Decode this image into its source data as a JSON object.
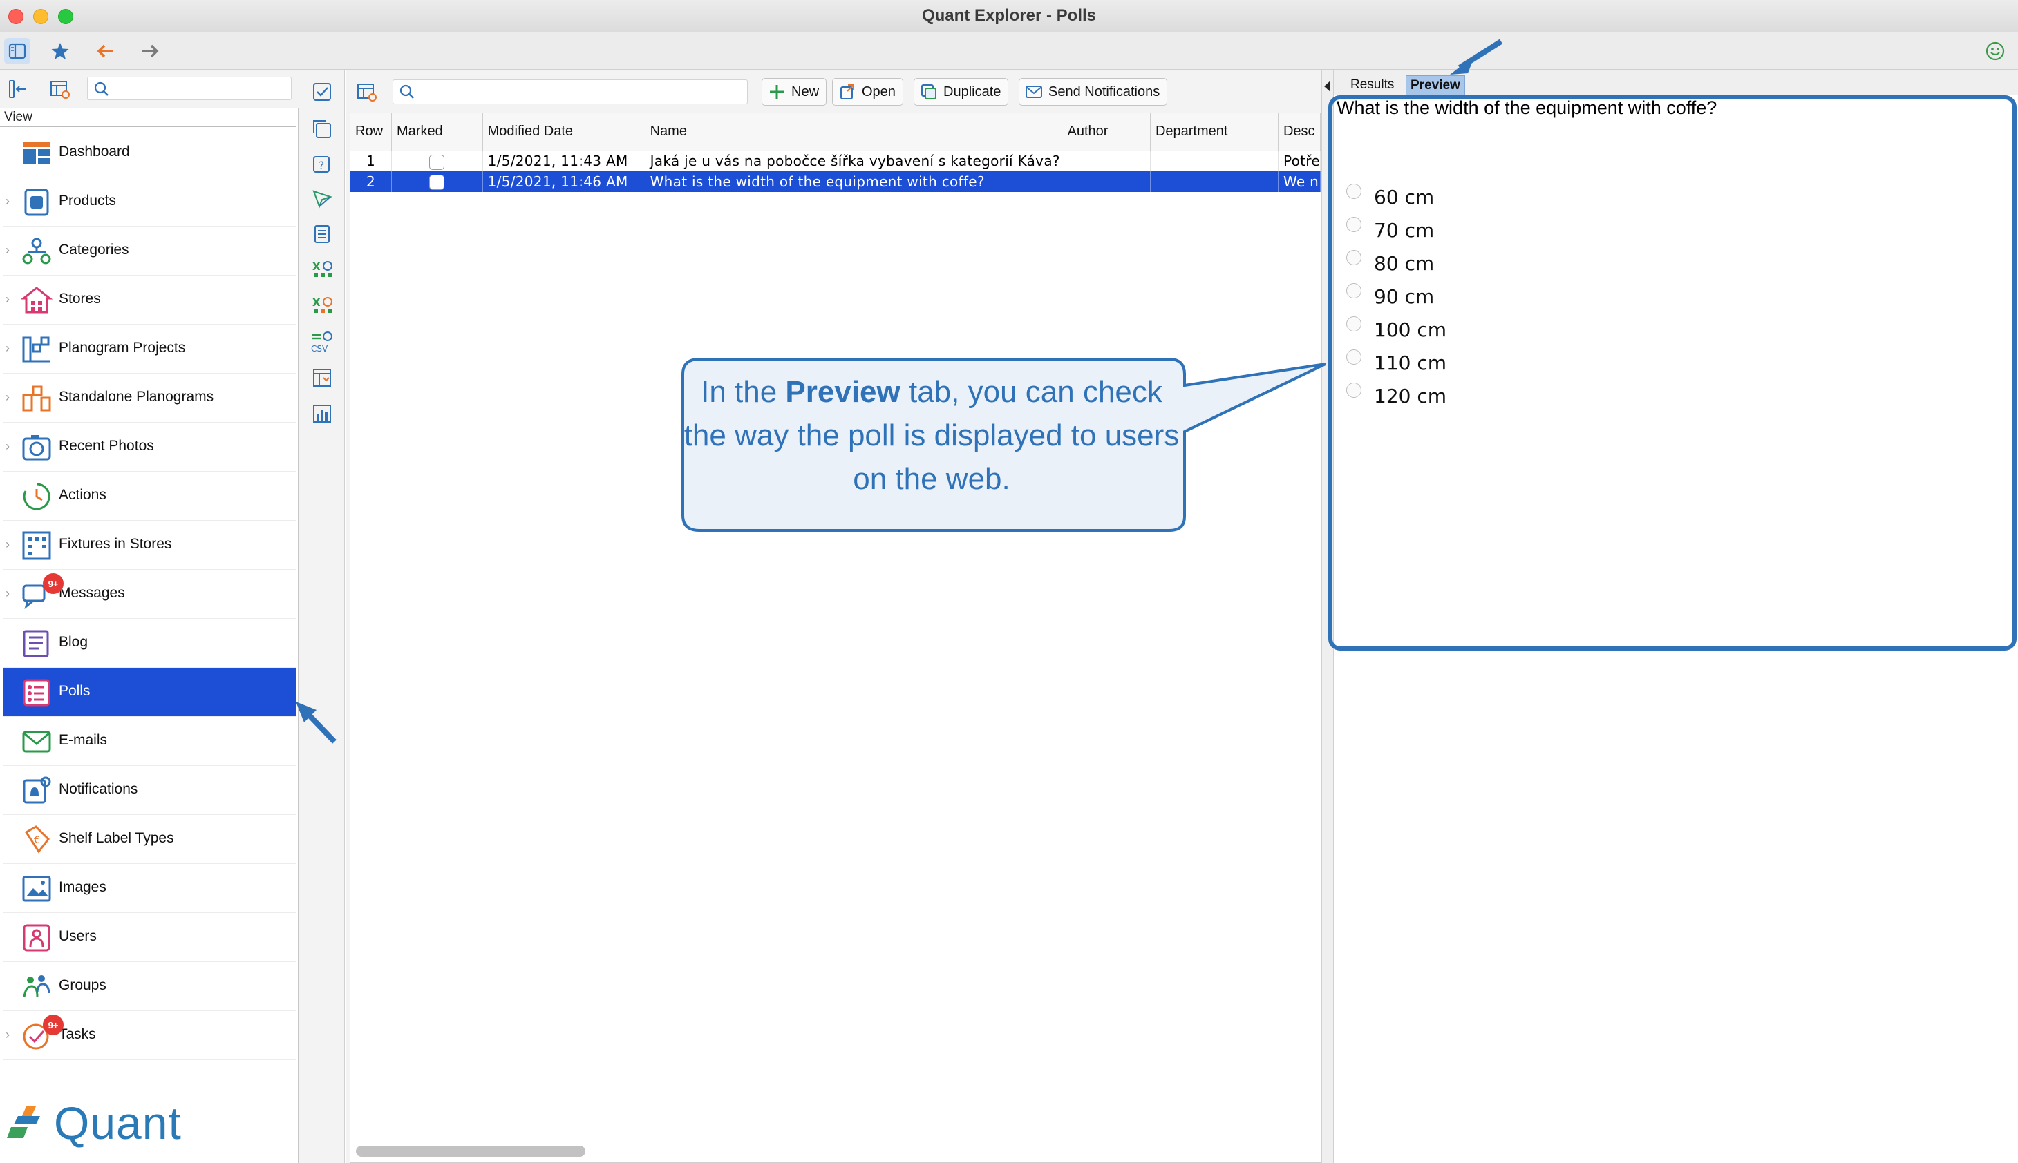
{
  "window": {
    "title": "Quant Explorer - Polls"
  },
  "sidebar": {
    "view_label": "View",
    "items": [
      {
        "label": "Dashboard",
        "icon": "dashboard-icon",
        "expandable": false
      },
      {
        "label": "Products",
        "icon": "products-icon",
        "expandable": true
      },
      {
        "label": "Categories",
        "icon": "categories-icon",
        "expandable": true
      },
      {
        "label": "Stores",
        "icon": "stores-icon",
        "expandable": true
      },
      {
        "label": "Planogram Projects",
        "icon": "planogram-projects-icon",
        "expandable": true
      },
      {
        "label": "Standalone Planograms",
        "icon": "standalone-planograms-icon",
        "expandable": true
      },
      {
        "label": "Recent Photos",
        "icon": "camera-icon",
        "expandable": true
      },
      {
        "label": "Actions",
        "icon": "actions-icon",
        "expandable": false
      },
      {
        "label": "Fixtures in Stores",
        "icon": "fixtures-icon",
        "expandable": true
      },
      {
        "label": "Messages",
        "icon": "messages-icon",
        "expandable": true,
        "badge": "9+"
      },
      {
        "label": "Blog",
        "icon": "blog-icon",
        "expandable": false
      },
      {
        "label": "Polls",
        "icon": "polls-icon",
        "expandable": false,
        "selected": true
      },
      {
        "label": "E-mails",
        "icon": "email-icon",
        "expandable": false
      },
      {
        "label": "Notifications",
        "icon": "notifications-icon",
        "expandable": false
      },
      {
        "label": "Shelf Label Types",
        "icon": "shelf-label-icon",
        "expandable": false
      },
      {
        "label": "Images",
        "icon": "images-icon",
        "expandable": false
      },
      {
        "label": "Users",
        "icon": "users-icon",
        "expandable": false
      },
      {
        "label": "Groups",
        "icon": "groups-icon",
        "expandable": false
      },
      {
        "label": "Tasks",
        "icon": "tasks-icon",
        "expandable": true,
        "badge": "9+"
      }
    ],
    "logo_text": "Quant"
  },
  "toolbar": {
    "new_label": "New",
    "open_label": "Open",
    "duplicate_label": "Duplicate",
    "send_label": "Send Notifications"
  },
  "table": {
    "columns": [
      "Row",
      "Marked",
      "Modified Date",
      "Name",
      "Author",
      "Department",
      "Desc"
    ],
    "rows": [
      {
        "row": "1",
        "modified": "1/5/2021, 11:43 AM",
        "name": "Jaká je u vás na pobočce šířka vybavení s kategorií Káva?",
        "author": "",
        "department": "",
        "desc": "Potře",
        "selected": false
      },
      {
        "row": "2",
        "modified": "1/5/2021, 11:46 AM",
        "name": "What is the width of the equipment with coffe?",
        "author": "",
        "department": "",
        "desc": "We n",
        "selected": true
      }
    ]
  },
  "right_tabs": {
    "results": "Results",
    "preview": "Preview"
  },
  "preview": {
    "question": "What is the width of the equipment with coffe?",
    "options": [
      "60 cm",
      "70 cm",
      "80 cm",
      "90 cm",
      "100 cm",
      "110 cm",
      "120 cm"
    ]
  },
  "callout": {
    "text_before": "In the ",
    "bold": "Preview",
    "text_after": " tab, you can check the way the poll is displayed to users on the web."
  },
  "colors": {
    "accent": "#1d4fd6",
    "annotation": "#2f72b8",
    "preview_tab": "#a7c6ea",
    "badge": "#e53935"
  }
}
